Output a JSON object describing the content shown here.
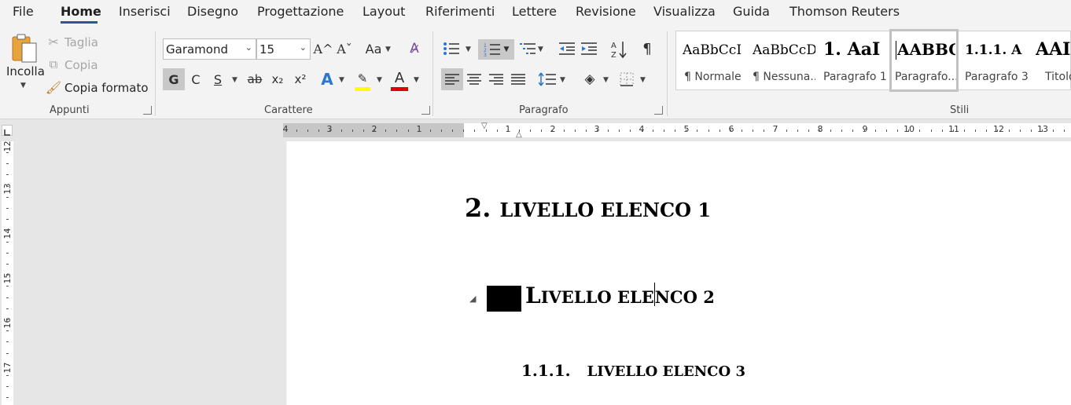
{
  "menu": {
    "tabs": [
      "File",
      "Home",
      "Inserisci",
      "Disegno",
      "Progettazione",
      "Layout",
      "Riferimenti",
      "Lettere",
      "Revisione",
      "Visualizza",
      "Guida",
      "Thomson Reuters"
    ]
  },
  "clipboard": {
    "paste_label": "Incolla",
    "cut_label": "Taglia",
    "copy_label": "Copia",
    "format_painter_label": "Copia formato",
    "group_label": "Appunti"
  },
  "font": {
    "family": "Garamond",
    "size": "15",
    "bold_label": "G",
    "italic_label": "C",
    "underline_label": "S",
    "strike_label": "ab",
    "subscript_label": "x₂",
    "superscript_label": "x²",
    "grow_label": "A^",
    "shrink_label": "Aˇ",
    "case_label": "Aa",
    "effects_label": "A",
    "font_color_label": "A",
    "group_label": "Carattere",
    "highlight_color": "#ffff00",
    "font_color": "#e00000"
  },
  "paragraph": {
    "group_label": "Paragrafo",
    "pilcrow": "¶"
  },
  "styles": {
    "group_label": "Stili",
    "items": [
      {
        "preview": "AaBbCcI",
        "name": "¶ Normale"
      },
      {
        "preview": "AaBbCcD",
        "name": "¶ Nessuna..."
      },
      {
        "preview": "1.  AaI",
        "name": "Paragrafo 1"
      },
      {
        "preview": "AABBC",
        "name": "Paragrafo..."
      },
      {
        "preview": "1.1.1.  A",
        "name": "Paragrafo 3"
      },
      {
        "preview": "AAI",
        "name": "Titolo"
      }
    ]
  },
  "ruler": {
    "left_numbers": [
      "4",
      "3",
      "2",
      "1"
    ],
    "right_numbers": [
      "1",
      "2",
      "3",
      "4",
      "5",
      "6",
      "7",
      "8",
      "9",
      "10",
      "11",
      "12",
      "13"
    ],
    "vertical_numbers": [
      "12",
      "13",
      "14",
      "15",
      "16",
      "17"
    ]
  },
  "document": {
    "h1_number": "2.",
    "h1_text": "LIVELLO ELENCO 1",
    "h2_text_first": "L",
    "h2_text_rest": "IVELLO ELE",
    "h2_text_after_cursor": "NCO 2",
    "h3_number": "1.1.1.",
    "h3_text": "LIVELLO ELENCO 3",
    "collapse_glyph": "◢"
  }
}
